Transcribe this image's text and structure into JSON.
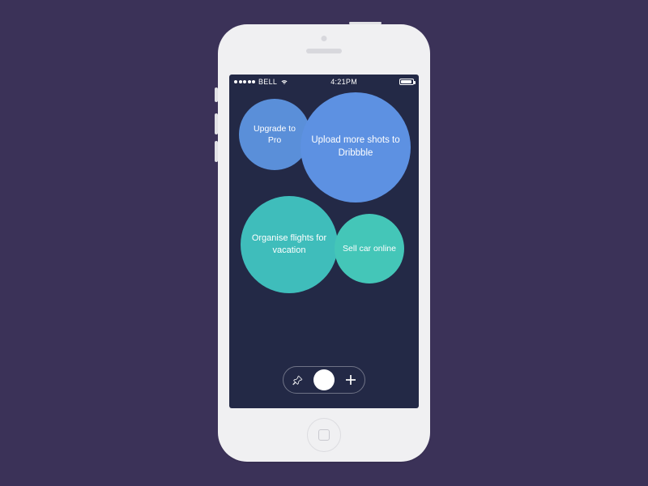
{
  "status_bar": {
    "carrier": "BELL",
    "time": "4:21PM"
  },
  "bubbles": {
    "upgrade": "Upgrade to Pro",
    "upload": "Upload more shots to Dribbble",
    "flights": "Organise flights for vacation",
    "sell": "Sell car online"
  },
  "toolbar": {
    "pin_label": "pin",
    "add_label": "add"
  }
}
